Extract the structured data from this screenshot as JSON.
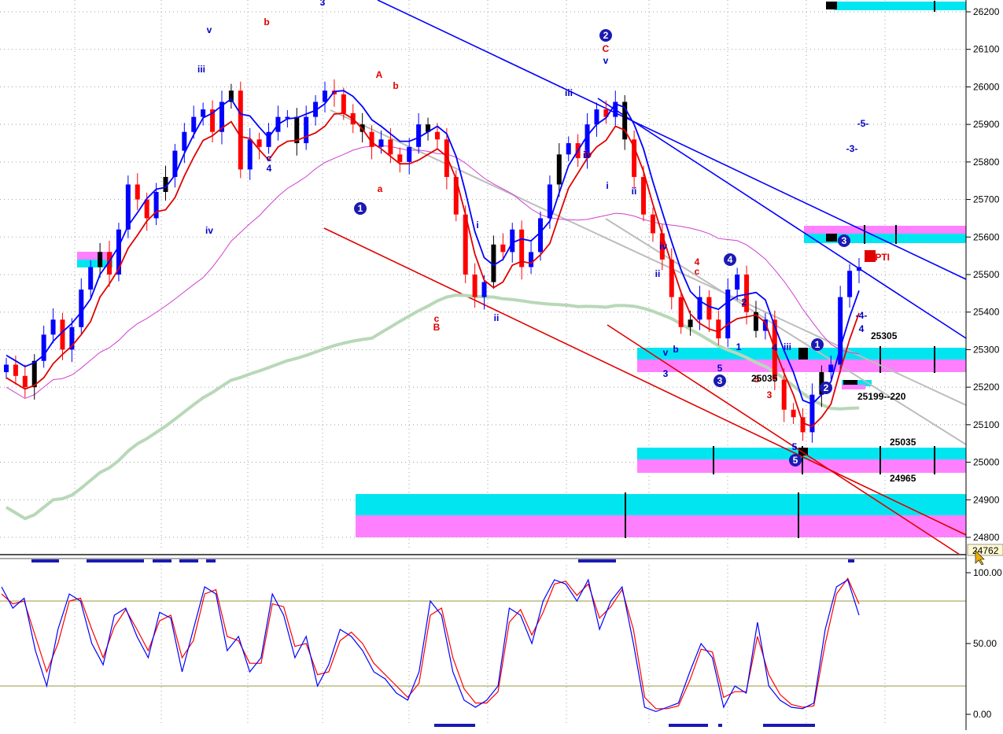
{
  "colors": {
    "background": "#ffffff",
    "grid": "#9aa0a6",
    "up_candle": "#0000ff",
    "down_candle": "#ff0000",
    "neutral_candle": "#000000",
    "blue_band": "#0000ff",
    "red_band": "#e00000",
    "ma_magenta": "#d040d0",
    "ma_green": "#b8d8b8",
    "gray_line": "#bdbdbd",
    "cyan_zone": "#00e5f0",
    "magenta_zone": "#ff80ff",
    "stoch_k": "#0000ff",
    "stoch_d": "#ff0000",
    "level_line": "#9a9a40"
  },
  "chart_data": [
    {
      "type": "candlestick",
      "y_axis": {
        "ticks": [
          "26200",
          "26100",
          "26000",
          "25900",
          "25800",
          "25700",
          "25600",
          "25500",
          "25400",
          "25300",
          "25200",
          "25100",
          "25000",
          "24900",
          "24800"
        ],
        "range": [
          24770,
          26220
        ],
        "last_price_label": "24762"
      },
      "price_labels": [
        "25305",
        "25199--220",
        "25035",
        "24965",
        "25035"
      ],
      "indicator_tag": "48PTI",
      "wave_labels": {
        "red": [
          "b",
          "A",
          "b",
          "a",
          "C",
          "c",
          "B",
          "c",
          "4",
          "2",
          "4",
          "3",
          "5",
          "iv"
        ],
        "blue": [
          "v",
          "iii",
          "iv",
          "c",
          "4",
          "3",
          "i",
          "ii",
          "iii",
          "iv",
          "v",
          "i",
          "ii",
          "iv",
          "ii",
          "v",
          "b",
          "3",
          "5",
          "1",
          "iii",
          "2",
          "4",
          "5",
          "-5-",
          "-3-",
          "-4-",
          "4"
        ],
        "circled": [
          "1",
          "2",
          "4",
          "3",
          "5",
          "1",
          "2",
          "3"
        ]
      },
      "series": [
        {
          "name": "close",
          "values": [
            25260,
            25230,
            25200,
            25270,
            25340,
            25380,
            25300,
            25360,
            25460,
            25520,
            25560,
            25500,
            25620,
            25740,
            25700,
            25650,
            25720,
            25760,
            25830,
            25880,
            25920,
            25940,
            25880,
            25960,
            25990,
            25780,
            25860,
            25840,
            25880,
            25920,
            25920,
            25850,
            25920,
            25960,
            25990,
            25980,
            25930,
            25900,
            25880,
            25840,
            25860,
            25820,
            25800,
            25840,
            25900,
            25880,
            25860,
            25760,
            25660,
            25500,
            25440,
            25480,
            25580,
            25560,
            25620,
            25520,
            25560,
            25650,
            25740,
            25820,
            25850,
            25810,
            25900,
            25940,
            25920,
            25960,
            25860,
            25760,
            25660,
            25610,
            25540,
            25440,
            25360,
            25380,
            25440,
            25380,
            25330,
            25460,
            25500,
            25400,
            25350,
            25380,
            25220,
            25140,
            25120,
            25080,
            25180,
            25240,
            25260,
            25440,
            25510,
            25520
          ]
        }
      ]
    },
    {
      "type": "line",
      "y_axis": {
        "ticks": [
          "100.00",
          "50.00",
          "0.00"
        ],
        "range": [
          0,
          100
        ],
        "levels": [
          80,
          20
        ]
      },
      "series": [
        {
          "name": "%K",
          "values": [
            90,
            75,
            82,
            45,
            20,
            60,
            85,
            80,
            50,
            35,
            70,
            75,
            55,
            40,
            72,
            68,
            30,
            60,
            90,
            85,
            45,
            55,
            30,
            40,
            85,
            70,
            40,
            55,
            20,
            35,
            60,
            55,
            45,
            30,
            25,
            15,
            10,
            30,
            80,
            70,
            30,
            10,
            5,
            10,
            20,
            75,
            70,
            50,
            80,
            95,
            92,
            80,
            95,
            60,
            80,
            90,
            50,
            5,
            2,
            5,
            8,
            30,
            50,
            40,
            5,
            20,
            15,
            65,
            20,
            10,
            5,
            4,
            8,
            60,
            90,
            95,
            70
          ]
        },
        {
          "name": "%D",
          "values": [
            85,
            78,
            80,
            55,
            30,
            50,
            80,
            82,
            60,
            40,
            62,
            74,
            60,
            45,
            66,
            70,
            40,
            52,
            85,
            88,
            55,
            52,
            36,
            36,
            78,
            76,
            48,
            50,
            28,
            30,
            52,
            58,
            50,
            36,
            28,
            20,
            12,
            22,
            70,
            75,
            40,
            18,
            8,
            8,
            16,
            65,
            74,
            56,
            72,
            92,
            94,
            84,
            92,
            68,
            76,
            88,
            60,
            12,
            4,
            4,
            6,
            24,
            46,
            44,
            12,
            16,
            16,
            55,
            28,
            14,
            7,
            5,
            6,
            50,
            85,
            96,
            78
          ]
        }
      ]
    }
  ]
}
